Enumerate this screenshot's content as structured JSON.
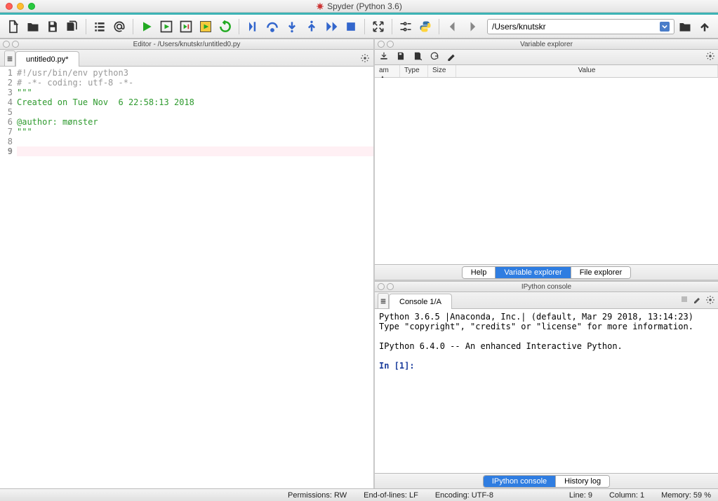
{
  "window": {
    "title": "Spyder (Python 3.6)"
  },
  "toolbar": {
    "path": "/Users/knutskr"
  },
  "editor": {
    "pane_title": "Editor - /Users/knutskr/untitled0.py",
    "tab_label": "untitled0.py*",
    "lines": [
      {
        "n": 1,
        "text": "#!/usr/bin/env python3",
        "cls": "c-gray"
      },
      {
        "n": 2,
        "text": "# -*- coding: utf-8 -*-",
        "cls": "c-gray"
      },
      {
        "n": 3,
        "text": "\"\"\"",
        "cls": "c-green"
      },
      {
        "n": 4,
        "text": "Created on Tue Nov  6 22:58:13 2018",
        "cls": "c-green"
      },
      {
        "n": 5,
        "text": "",
        "cls": "c-green"
      },
      {
        "n": 6,
        "text": "@author: mønster",
        "cls": "c-green"
      },
      {
        "n": 7,
        "text": "\"\"\"",
        "cls": "c-green"
      },
      {
        "n": 8,
        "text": "",
        "cls": ""
      },
      {
        "n": 9,
        "text": "",
        "cls": "hl"
      }
    ]
  },
  "var_explorer": {
    "pane_title": "Variable explorer",
    "cols": {
      "name": "am",
      "sort": "▲",
      "type": "Type",
      "size": "Size",
      "value": "Value"
    },
    "tabs": {
      "help": "Help",
      "var": "Variable explorer",
      "file": "File explorer"
    }
  },
  "console": {
    "pane_title": "IPython console",
    "tab_label": "Console 1/A",
    "line1": "Python 3.6.5 |Anaconda, Inc.| (default, Mar 29 2018, 13:14:23)",
    "line2": "Type \"copyright\", \"credits\" or \"license\" for more information.",
    "line3": "IPython 6.4.0 -- An enhanced Interactive Python.",
    "prompt": "In [1]:",
    "tabs": {
      "ipy": "IPython console",
      "hist": "History log"
    }
  },
  "status": {
    "perm": "Permissions:  RW",
    "eol": "End-of-lines:  LF",
    "enc": "Encoding:  UTF-8",
    "line": "Line:  9",
    "col": "Column:  1",
    "mem": "Memory:  59 %"
  }
}
